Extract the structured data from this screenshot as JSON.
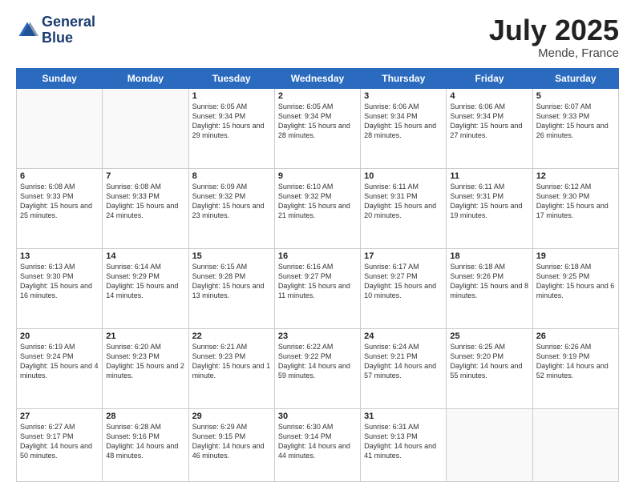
{
  "header": {
    "logo_line1": "General",
    "logo_line2": "Blue",
    "title": "July 2025",
    "location": "Mende, France"
  },
  "days_of_week": [
    "Sunday",
    "Monday",
    "Tuesday",
    "Wednesday",
    "Thursday",
    "Friday",
    "Saturday"
  ],
  "weeks": [
    [
      {
        "day": "",
        "info": ""
      },
      {
        "day": "",
        "info": ""
      },
      {
        "day": "1",
        "info": "Sunrise: 6:05 AM\nSunset: 9:34 PM\nDaylight: 15 hours and 29 minutes."
      },
      {
        "day": "2",
        "info": "Sunrise: 6:05 AM\nSunset: 9:34 PM\nDaylight: 15 hours and 28 minutes."
      },
      {
        "day": "3",
        "info": "Sunrise: 6:06 AM\nSunset: 9:34 PM\nDaylight: 15 hours and 28 minutes."
      },
      {
        "day": "4",
        "info": "Sunrise: 6:06 AM\nSunset: 9:34 PM\nDaylight: 15 hours and 27 minutes."
      },
      {
        "day": "5",
        "info": "Sunrise: 6:07 AM\nSunset: 9:33 PM\nDaylight: 15 hours and 26 minutes."
      }
    ],
    [
      {
        "day": "6",
        "info": "Sunrise: 6:08 AM\nSunset: 9:33 PM\nDaylight: 15 hours and 25 minutes."
      },
      {
        "day": "7",
        "info": "Sunrise: 6:08 AM\nSunset: 9:33 PM\nDaylight: 15 hours and 24 minutes."
      },
      {
        "day": "8",
        "info": "Sunrise: 6:09 AM\nSunset: 9:32 PM\nDaylight: 15 hours and 23 minutes."
      },
      {
        "day": "9",
        "info": "Sunrise: 6:10 AM\nSunset: 9:32 PM\nDaylight: 15 hours and 21 minutes."
      },
      {
        "day": "10",
        "info": "Sunrise: 6:11 AM\nSunset: 9:31 PM\nDaylight: 15 hours and 20 minutes."
      },
      {
        "day": "11",
        "info": "Sunrise: 6:11 AM\nSunset: 9:31 PM\nDaylight: 15 hours and 19 minutes."
      },
      {
        "day": "12",
        "info": "Sunrise: 6:12 AM\nSunset: 9:30 PM\nDaylight: 15 hours and 17 minutes."
      }
    ],
    [
      {
        "day": "13",
        "info": "Sunrise: 6:13 AM\nSunset: 9:30 PM\nDaylight: 15 hours and 16 minutes."
      },
      {
        "day": "14",
        "info": "Sunrise: 6:14 AM\nSunset: 9:29 PM\nDaylight: 15 hours and 14 minutes."
      },
      {
        "day": "15",
        "info": "Sunrise: 6:15 AM\nSunset: 9:28 PM\nDaylight: 15 hours and 13 minutes."
      },
      {
        "day": "16",
        "info": "Sunrise: 6:16 AM\nSunset: 9:27 PM\nDaylight: 15 hours and 11 minutes."
      },
      {
        "day": "17",
        "info": "Sunrise: 6:17 AM\nSunset: 9:27 PM\nDaylight: 15 hours and 10 minutes."
      },
      {
        "day": "18",
        "info": "Sunrise: 6:18 AM\nSunset: 9:26 PM\nDaylight: 15 hours and 8 minutes."
      },
      {
        "day": "19",
        "info": "Sunrise: 6:18 AM\nSunset: 9:25 PM\nDaylight: 15 hours and 6 minutes."
      }
    ],
    [
      {
        "day": "20",
        "info": "Sunrise: 6:19 AM\nSunset: 9:24 PM\nDaylight: 15 hours and 4 minutes."
      },
      {
        "day": "21",
        "info": "Sunrise: 6:20 AM\nSunset: 9:23 PM\nDaylight: 15 hours and 2 minutes."
      },
      {
        "day": "22",
        "info": "Sunrise: 6:21 AM\nSunset: 9:23 PM\nDaylight: 15 hours and 1 minute."
      },
      {
        "day": "23",
        "info": "Sunrise: 6:22 AM\nSunset: 9:22 PM\nDaylight: 14 hours and 59 minutes."
      },
      {
        "day": "24",
        "info": "Sunrise: 6:24 AM\nSunset: 9:21 PM\nDaylight: 14 hours and 57 minutes."
      },
      {
        "day": "25",
        "info": "Sunrise: 6:25 AM\nSunset: 9:20 PM\nDaylight: 14 hours and 55 minutes."
      },
      {
        "day": "26",
        "info": "Sunrise: 6:26 AM\nSunset: 9:19 PM\nDaylight: 14 hours and 52 minutes."
      }
    ],
    [
      {
        "day": "27",
        "info": "Sunrise: 6:27 AM\nSunset: 9:17 PM\nDaylight: 14 hours and 50 minutes."
      },
      {
        "day": "28",
        "info": "Sunrise: 6:28 AM\nSunset: 9:16 PM\nDaylight: 14 hours and 48 minutes."
      },
      {
        "day": "29",
        "info": "Sunrise: 6:29 AM\nSunset: 9:15 PM\nDaylight: 14 hours and 46 minutes."
      },
      {
        "day": "30",
        "info": "Sunrise: 6:30 AM\nSunset: 9:14 PM\nDaylight: 14 hours and 44 minutes."
      },
      {
        "day": "31",
        "info": "Sunrise: 6:31 AM\nSunset: 9:13 PM\nDaylight: 14 hours and 41 minutes."
      },
      {
        "day": "",
        "info": ""
      },
      {
        "day": "",
        "info": ""
      }
    ]
  ]
}
